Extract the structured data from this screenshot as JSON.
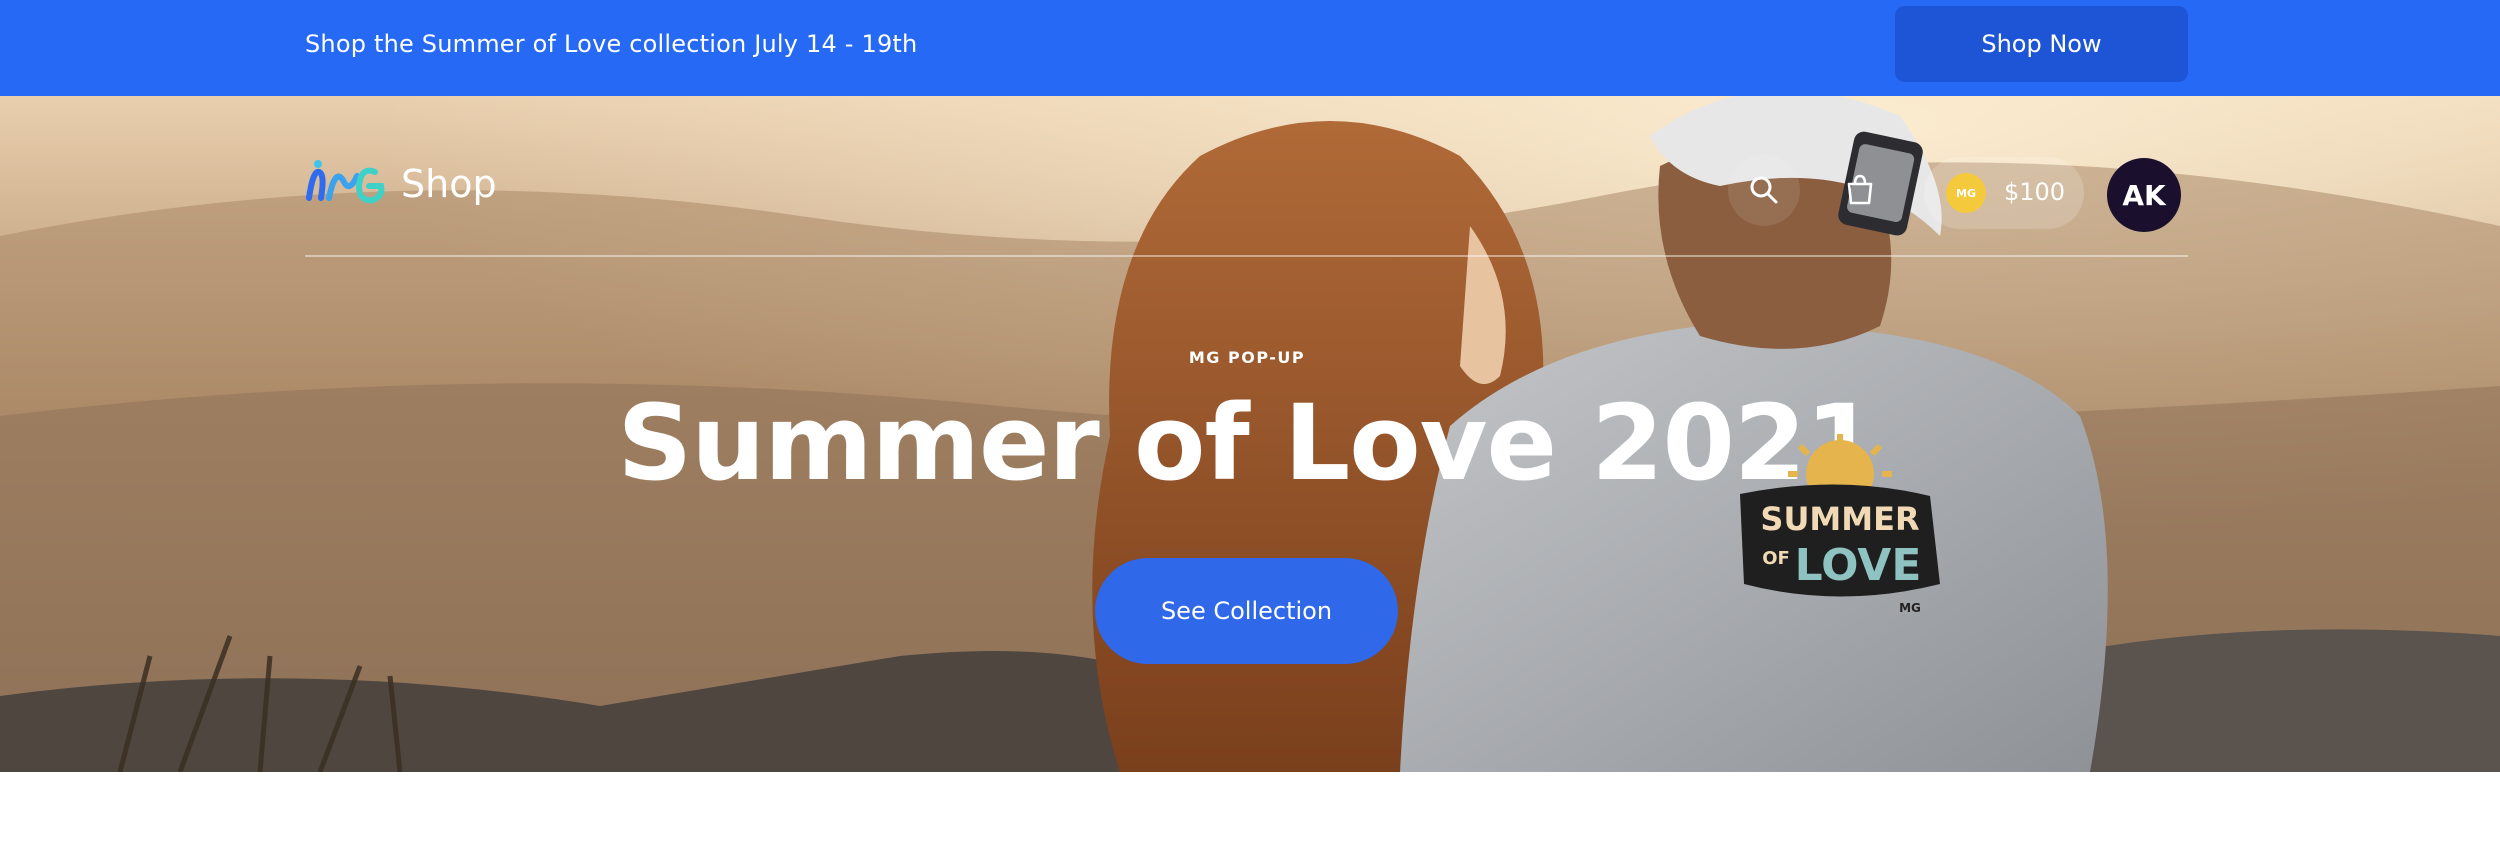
{
  "promo": {
    "text": "Shop the Summer of Love collection July 14 - 19th",
    "button_label": "Shop Now"
  },
  "header": {
    "logo_text": "Shop",
    "search_icon": "search-icon",
    "cart_icon": "shopping-bag-icon",
    "credits": {
      "coin_label": "MG",
      "amount": "$100"
    },
    "avatar_initials": "AK"
  },
  "hero": {
    "eyebrow": "MG POP-UP",
    "title": "Summer of Love 2021",
    "cta_label": "See Collection",
    "shirt_text": {
      "line1": "SUMMER",
      "line2": "OF",
      "line3": "LOVE",
      "mark": "MG"
    }
  },
  "colors": {
    "primary": "#2669f5",
    "button_dark": "#1d55d6",
    "cta": "#2f68e8",
    "avatar_bg": "#1b0f2e",
    "coin": "#f5c93c"
  }
}
